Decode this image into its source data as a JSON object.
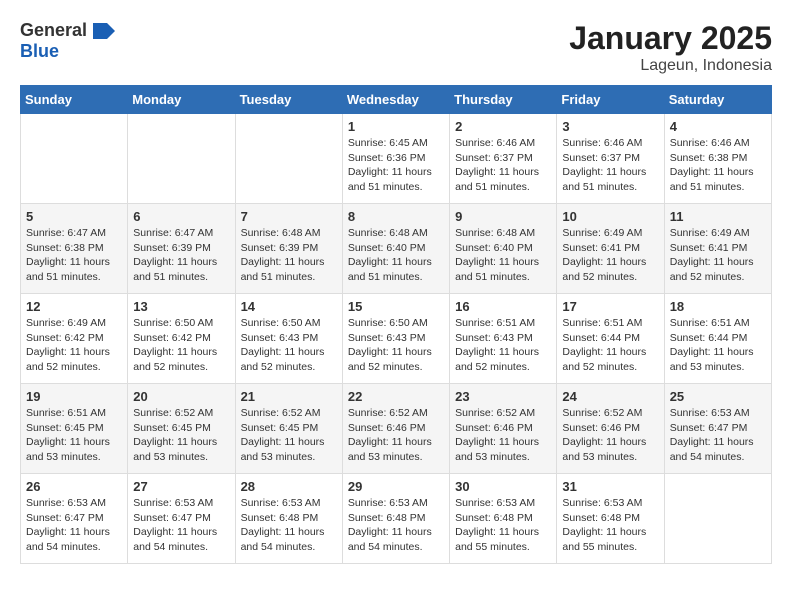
{
  "header": {
    "logo_general": "General",
    "logo_blue": "Blue",
    "title": "January 2025",
    "subtitle": "Lageun, Indonesia"
  },
  "weekdays": [
    "Sunday",
    "Monday",
    "Tuesday",
    "Wednesday",
    "Thursday",
    "Friday",
    "Saturday"
  ],
  "weeks": [
    [
      {
        "day": "",
        "info": ""
      },
      {
        "day": "",
        "info": ""
      },
      {
        "day": "",
        "info": ""
      },
      {
        "day": "1",
        "info": "Sunrise: 6:45 AM\nSunset: 6:36 PM\nDaylight: 11 hours\nand 51 minutes."
      },
      {
        "day": "2",
        "info": "Sunrise: 6:46 AM\nSunset: 6:37 PM\nDaylight: 11 hours\nand 51 minutes."
      },
      {
        "day": "3",
        "info": "Sunrise: 6:46 AM\nSunset: 6:37 PM\nDaylight: 11 hours\nand 51 minutes."
      },
      {
        "day": "4",
        "info": "Sunrise: 6:46 AM\nSunset: 6:38 PM\nDaylight: 11 hours\nand 51 minutes."
      }
    ],
    [
      {
        "day": "5",
        "info": "Sunrise: 6:47 AM\nSunset: 6:38 PM\nDaylight: 11 hours\nand 51 minutes."
      },
      {
        "day": "6",
        "info": "Sunrise: 6:47 AM\nSunset: 6:39 PM\nDaylight: 11 hours\nand 51 minutes."
      },
      {
        "day": "7",
        "info": "Sunrise: 6:48 AM\nSunset: 6:39 PM\nDaylight: 11 hours\nand 51 minutes."
      },
      {
        "day": "8",
        "info": "Sunrise: 6:48 AM\nSunset: 6:40 PM\nDaylight: 11 hours\nand 51 minutes."
      },
      {
        "day": "9",
        "info": "Sunrise: 6:48 AM\nSunset: 6:40 PM\nDaylight: 11 hours\nand 51 minutes."
      },
      {
        "day": "10",
        "info": "Sunrise: 6:49 AM\nSunset: 6:41 PM\nDaylight: 11 hours\nand 52 minutes."
      },
      {
        "day": "11",
        "info": "Sunrise: 6:49 AM\nSunset: 6:41 PM\nDaylight: 11 hours\nand 52 minutes."
      }
    ],
    [
      {
        "day": "12",
        "info": "Sunrise: 6:49 AM\nSunset: 6:42 PM\nDaylight: 11 hours\nand 52 minutes."
      },
      {
        "day": "13",
        "info": "Sunrise: 6:50 AM\nSunset: 6:42 PM\nDaylight: 11 hours\nand 52 minutes."
      },
      {
        "day": "14",
        "info": "Sunrise: 6:50 AM\nSunset: 6:43 PM\nDaylight: 11 hours\nand 52 minutes."
      },
      {
        "day": "15",
        "info": "Sunrise: 6:50 AM\nSunset: 6:43 PM\nDaylight: 11 hours\nand 52 minutes."
      },
      {
        "day": "16",
        "info": "Sunrise: 6:51 AM\nSunset: 6:43 PM\nDaylight: 11 hours\nand 52 minutes."
      },
      {
        "day": "17",
        "info": "Sunrise: 6:51 AM\nSunset: 6:44 PM\nDaylight: 11 hours\nand 52 minutes."
      },
      {
        "day": "18",
        "info": "Sunrise: 6:51 AM\nSunset: 6:44 PM\nDaylight: 11 hours\nand 53 minutes."
      }
    ],
    [
      {
        "day": "19",
        "info": "Sunrise: 6:51 AM\nSunset: 6:45 PM\nDaylight: 11 hours\nand 53 minutes."
      },
      {
        "day": "20",
        "info": "Sunrise: 6:52 AM\nSunset: 6:45 PM\nDaylight: 11 hours\nand 53 minutes."
      },
      {
        "day": "21",
        "info": "Sunrise: 6:52 AM\nSunset: 6:45 PM\nDaylight: 11 hours\nand 53 minutes."
      },
      {
        "day": "22",
        "info": "Sunrise: 6:52 AM\nSunset: 6:46 PM\nDaylight: 11 hours\nand 53 minutes."
      },
      {
        "day": "23",
        "info": "Sunrise: 6:52 AM\nSunset: 6:46 PM\nDaylight: 11 hours\nand 53 minutes."
      },
      {
        "day": "24",
        "info": "Sunrise: 6:52 AM\nSunset: 6:46 PM\nDaylight: 11 hours\nand 53 minutes."
      },
      {
        "day": "25",
        "info": "Sunrise: 6:53 AM\nSunset: 6:47 PM\nDaylight: 11 hours\nand 54 minutes."
      }
    ],
    [
      {
        "day": "26",
        "info": "Sunrise: 6:53 AM\nSunset: 6:47 PM\nDaylight: 11 hours\nand 54 minutes."
      },
      {
        "day": "27",
        "info": "Sunrise: 6:53 AM\nSunset: 6:47 PM\nDaylight: 11 hours\nand 54 minutes."
      },
      {
        "day": "28",
        "info": "Sunrise: 6:53 AM\nSunset: 6:48 PM\nDaylight: 11 hours\nand 54 minutes."
      },
      {
        "day": "29",
        "info": "Sunrise: 6:53 AM\nSunset: 6:48 PM\nDaylight: 11 hours\nand 54 minutes."
      },
      {
        "day": "30",
        "info": "Sunrise: 6:53 AM\nSunset: 6:48 PM\nDaylight: 11 hours\nand 55 minutes."
      },
      {
        "day": "31",
        "info": "Sunrise: 6:53 AM\nSunset: 6:48 PM\nDaylight: 11 hours\nand 55 minutes."
      },
      {
        "day": "",
        "info": ""
      }
    ]
  ]
}
